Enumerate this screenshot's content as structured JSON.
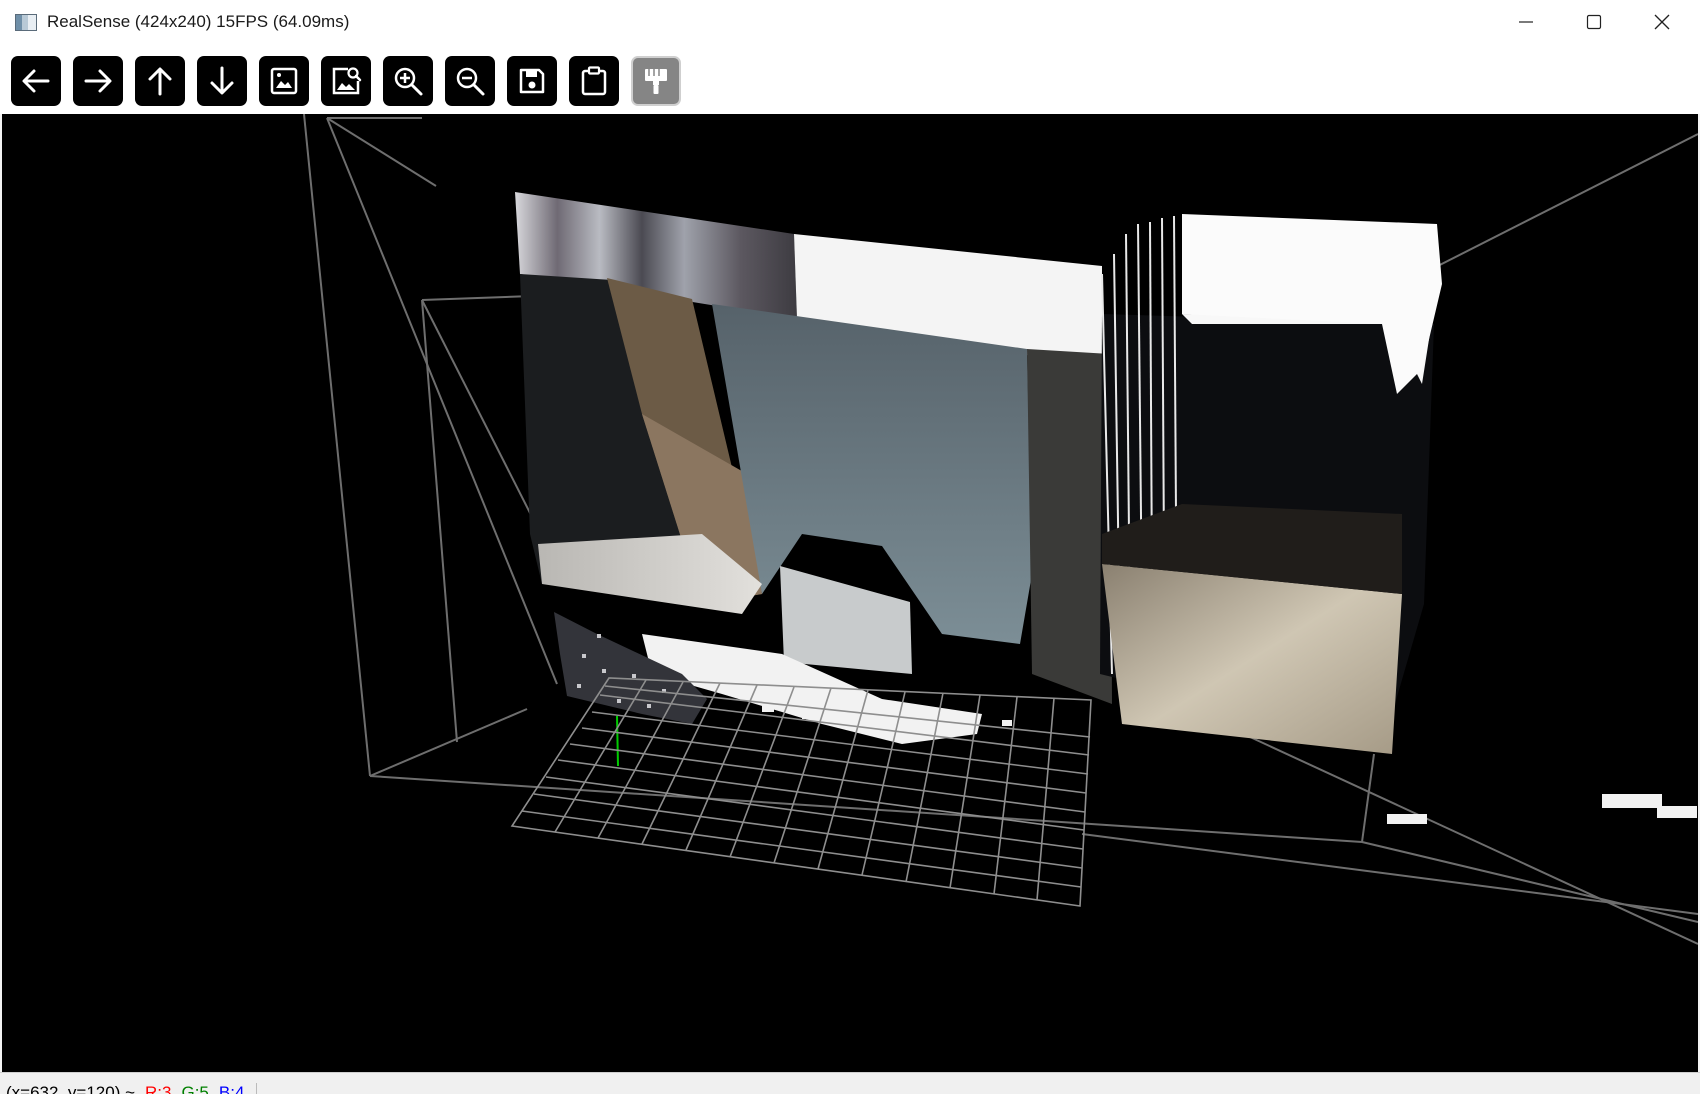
{
  "window": {
    "title": "RealSense (424x240) 15FPS (64.09ms)"
  },
  "toolbar": {
    "buttons": [
      {
        "name": "arrow-left-icon",
        "label": "Pan left",
        "enabled": true
      },
      {
        "name": "arrow-right-icon",
        "label": "Pan right",
        "enabled": true
      },
      {
        "name": "arrow-up-icon",
        "label": "Pan up",
        "enabled": true
      },
      {
        "name": "arrow-down-icon",
        "label": "Pan down",
        "enabled": true
      },
      {
        "name": "image-icon",
        "label": "Fit image",
        "enabled": true
      },
      {
        "name": "image-search-icon",
        "label": "Actual size",
        "enabled": true
      },
      {
        "name": "zoom-in-icon",
        "label": "Zoom in",
        "enabled": true
      },
      {
        "name": "zoom-out-icon",
        "label": "Zoom out",
        "enabled": true
      },
      {
        "name": "save-icon",
        "label": "Save",
        "enabled": true
      },
      {
        "name": "clipboard-icon",
        "label": "Copy",
        "enabled": true
      },
      {
        "name": "paint-roller-icon",
        "label": "Properties",
        "enabled": false
      }
    ]
  },
  "status": {
    "coords": "(x=632, y=120) ~",
    "r": "R:3",
    "g": "G:5",
    "b": "B:4",
    "colors": {
      "r": "#ff0000",
      "g": "#008000",
      "b": "#0000ff"
    }
  }
}
